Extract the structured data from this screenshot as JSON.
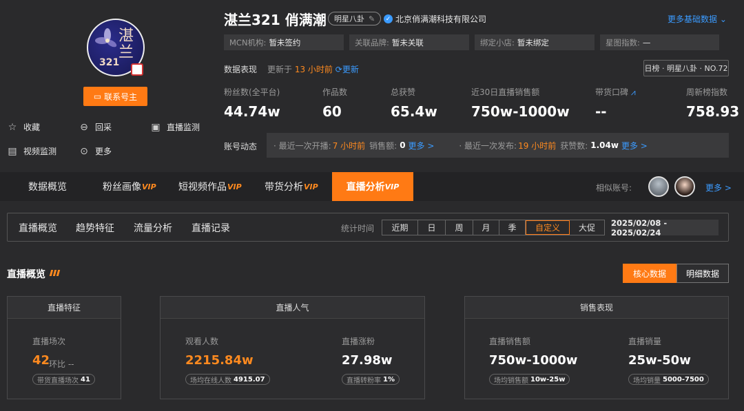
{
  "profile": {
    "avatar_text": "湛兰",
    "avatar_num": "321",
    "name": "湛兰321 俏满潮",
    "tag": "明星八卦",
    "company": "北京俏满潮科技有限公司",
    "more_basic": "更多基础数据",
    "contact_btn": "联系号主"
  },
  "actions": [
    {
      "icon": "star-icon",
      "label": "收藏"
    },
    {
      "icon": "back-icon",
      "label": "回采"
    },
    {
      "icon": "live-icon",
      "label": "直播监测"
    },
    {
      "icon": "video-icon",
      "label": "视频监测"
    },
    {
      "icon": "more-icon",
      "label": "更多"
    }
  ],
  "info": {
    "mcn_label": "MCN机构:",
    "mcn_value": "暂未签约",
    "brand_label": "关联品牌:",
    "brand_value": "暂未关联",
    "shop_label": "绑定小店:",
    "shop_value": "暂未绑定",
    "star_label": "星图指数:",
    "star_value": "—"
  },
  "performance": {
    "label": "数据表现",
    "update_prefix": "更新于",
    "update_time": "13 小时前",
    "update_btn": "更新",
    "rank": "日榜 · 明星八卦 · NO.72"
  },
  "stats": [
    {
      "label": "粉丝数(全平台)",
      "value": "44.74w"
    },
    {
      "label": "作品数",
      "value": "60"
    },
    {
      "label": "总获赞",
      "value": "65.4w"
    },
    {
      "label": "近30日直播销售额",
      "value": "750w-1000w"
    },
    {
      "label": "带货口碑",
      "value": "--"
    },
    {
      "label": "周新榜指数",
      "value": "758.93"
    }
  ],
  "dynamics": {
    "label": "账号动态",
    "live_prefix": "· 最近一次开播:",
    "live_time": "7 小时前",
    "sales_label": "销售额:",
    "sales_value": "0",
    "more1": "更多 >",
    "pub_prefix": "· 最近一次发布:",
    "pub_time": "19 小时前",
    "likes_label": "获赞数:",
    "likes_value": "1.04w",
    "more2": "更多 >"
  },
  "nav": {
    "items": [
      {
        "label": "数据概览",
        "vip": ""
      },
      {
        "label": "粉丝画像",
        "vip": "VIP"
      },
      {
        "label": "短视频作品",
        "vip": "VIP"
      },
      {
        "label": "带货分析",
        "vip": "VIP"
      }
    ],
    "active": {
      "label": "直播分析",
      "vip": "VIP"
    },
    "similar_label": "相似账号:",
    "more": "更多 >"
  },
  "subtabs": [
    "直播概览",
    "趋势特征",
    "流量分析",
    "直播记录"
  ],
  "period": {
    "label": "统计时间",
    "options": [
      "近期",
      "日",
      "周",
      "月",
      "季",
      "自定义",
      "大促"
    ],
    "active": "自定义",
    "range": "2025/02/08 - 2025/02/24"
  },
  "overview": {
    "title": "直播概览",
    "core_btn": "核心数据",
    "detail_btn": "明细数据"
  },
  "cards": {
    "feature": {
      "title": "直播特征",
      "lbl": "直播场次",
      "val": "42",
      "ratio": "环比 --",
      "pill_lbl": "带货直播场次",
      "pill_val": "41"
    },
    "popularity": {
      "title": "直播人气",
      "lbl1": "观看人数",
      "val1": "2215.84w",
      "pill1_lbl": "场均在线人数",
      "pill1_val": "4915.07",
      "lbl2": "直播涨粉",
      "val2": "27.98w",
      "pill2_lbl": "直播转粉率",
      "pill2_val": "1%"
    },
    "sales": {
      "title": "销售表现",
      "lbl1": "直播销售额",
      "val1": "750w-1000w",
      "pill1_lbl": "场均销售额",
      "pill1_val": "10w-25w",
      "lbl2": "直播销量",
      "val2": "25w-50w",
      "pill2_lbl": "场均销量",
      "pill2_val": "5000-7500"
    }
  }
}
